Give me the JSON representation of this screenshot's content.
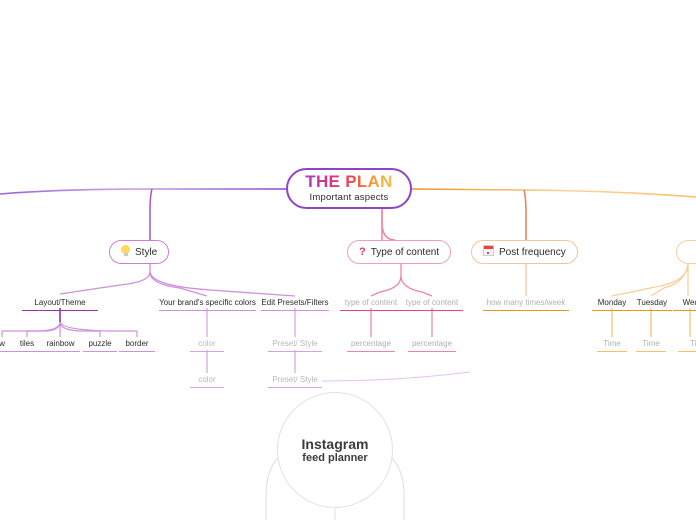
{
  "root": {
    "title": "THE PLAN",
    "subtitle": "Important aspects"
  },
  "branches": {
    "style": {
      "label": "Style",
      "icon": "lightbulb-icon"
    },
    "type_of_content": {
      "label": "Type of content",
      "icon": "question-mark-icon"
    },
    "post_frequency": {
      "label": "Post frequency",
      "icon": "calendar-icon"
    }
  },
  "style_children": {
    "layout_theme": "Layout/Theme",
    "brand_colors": "Your brand's specific colors",
    "edit_presets": "Edit Presets/Filters"
  },
  "layout_options": [
    "w",
    "tiles",
    "rainbow",
    "puzzle",
    "border"
  ],
  "brand_color_items": [
    "color",
    "color"
  ],
  "preset_items": [
    "Preset/ Style",
    "Preset/ Style"
  ],
  "content_items": [
    {
      "label": "type of content",
      "child": "percentage"
    },
    {
      "label": "type of content",
      "child": "percentage"
    }
  ],
  "frequency_items": {
    "how_often": "how many times/week"
  },
  "days": [
    {
      "label": "Monday",
      "time": "Time"
    },
    {
      "label": "Tuesday",
      "time": "Time"
    },
    {
      "label": "Wedn",
      "time": "Ti"
    }
  ],
  "center": {
    "title": "Instagram",
    "subtitle": "feed planner"
  },
  "colors": {
    "purple": "#8e44c8",
    "lilac": "#cf8fdd",
    "pink": "#f0849c",
    "red_pink": "#ef3b4e",
    "orange": "#f0921f",
    "orange_light": "#f8c264",
    "grey_line": "#e2e2e2",
    "text": "#2b2b2b",
    "placeholder": "#b0b0b0",
    "background": "#ffffff"
  }
}
